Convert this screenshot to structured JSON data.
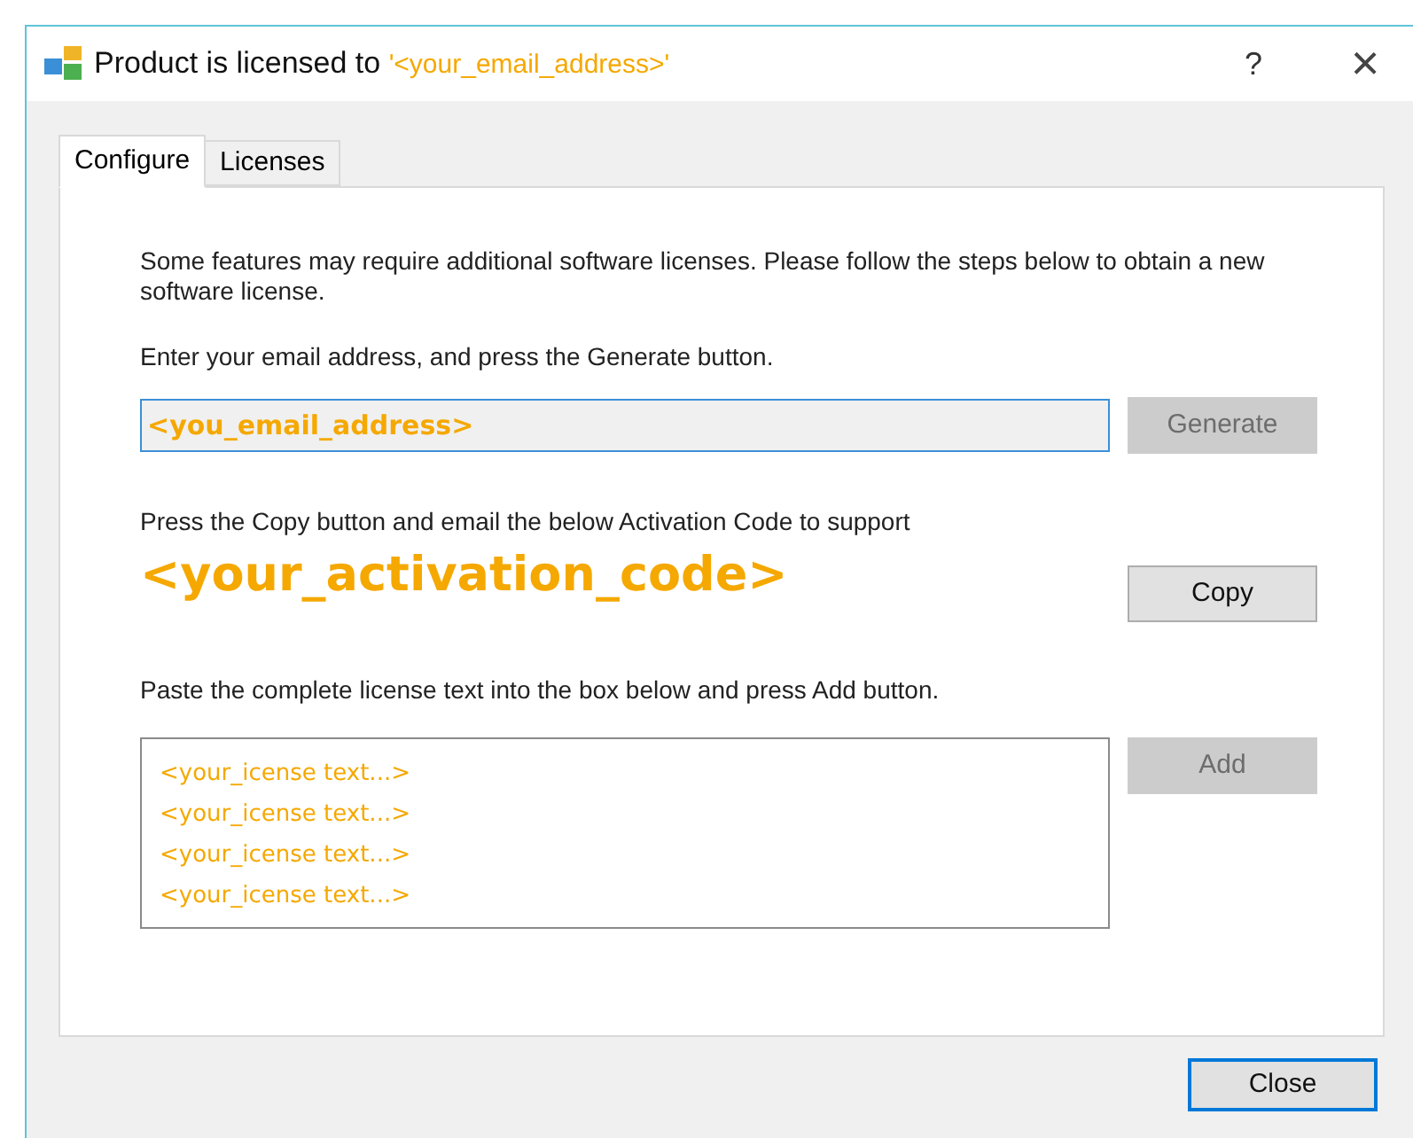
{
  "window": {
    "title": "Product is licensed to ",
    "title_highlight": "'<your_email_address>'",
    "help": "?",
    "close": "×"
  },
  "tabs": [
    {
      "label": "Configure",
      "selected": true
    },
    {
      "label": "Licenses",
      "selected": false
    }
  ],
  "intro": "Some features may require additional software licenses.  Please follow the steps below to obtain a new software license.",
  "email_step": {
    "label": "Enter your email address, and press the Generate button.",
    "value": "<you_email_address>",
    "button": {
      "label": "Generate",
      "disabled": true
    }
  },
  "copy_step": {
    "label": "Press the Copy button and email the below Activation Code to support",
    "code": "<your_activation_code>",
    "button": {
      "label": "Copy",
      "disabled": false
    }
  },
  "license_step": {
    "label": "Paste the complete license text into the box below and press Add button.",
    "lines": [
      "<your_icense text...>",
      "<your_icense text...>",
      "<your_icense text...>",
      "<your_icense text...>"
    ],
    "button": {
      "label": "Add",
      "disabled": true
    }
  },
  "footer": {
    "button": "Close"
  }
}
